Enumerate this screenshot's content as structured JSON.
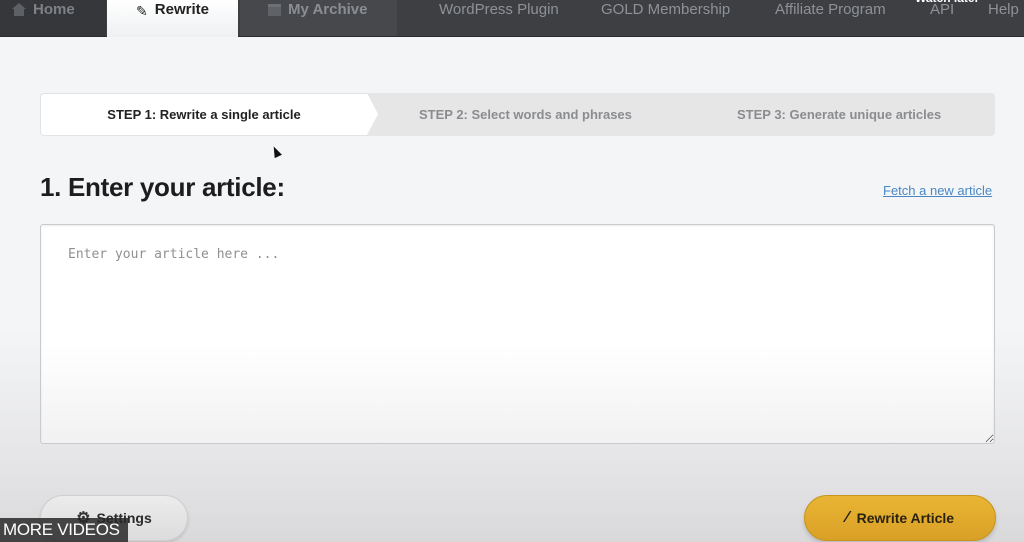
{
  "nav": {
    "home": "Home",
    "rewrite": "Rewrite",
    "archive": "My Archive",
    "links": [
      "WordPress Plugin",
      "GOLD Membership",
      "Affiliate Program",
      "API",
      "Help"
    ],
    "overlay_text": "Watch later"
  },
  "steps": {
    "step1": "STEP 1: Rewrite a single article",
    "step2": "STEP 2: Select words and phrases",
    "step3": "STEP 3: Generate unique articles",
    "active": 1
  },
  "main": {
    "title": "1. Enter your article:",
    "fetch_link": "Fetch a new article",
    "article_value": "",
    "article_placeholder": "Enter your article here ..."
  },
  "buttons": {
    "settings": "Settings",
    "rewrite_article": "Rewrite Article"
  },
  "overlay": {
    "more_videos": "MORE VIDEOS"
  },
  "colors": {
    "nav_bg": "#3d3f43",
    "accent_button": "#e2ab2e",
    "link": "#4a88c5"
  }
}
